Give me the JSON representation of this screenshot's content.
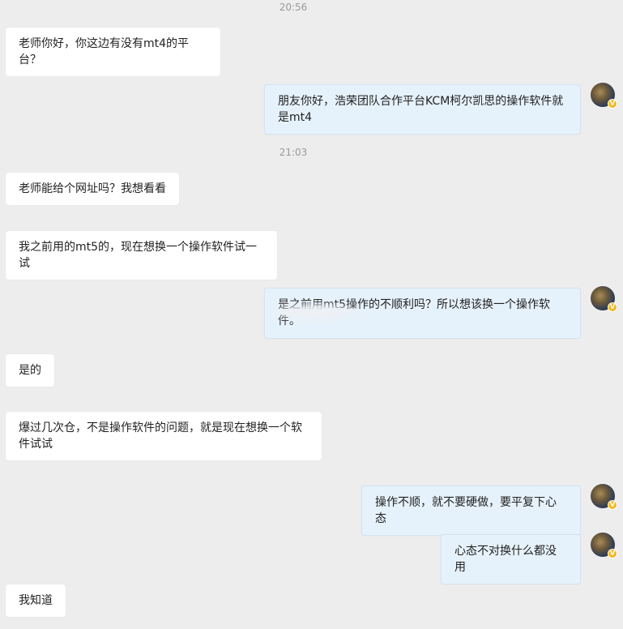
{
  "timestamps": [
    "20:56",
    "21:03"
  ],
  "messages": [
    {
      "side": "in",
      "text": "老师你好，你这边有没有mt4的平台？"
    },
    {
      "side": "out",
      "text": "朋友你好，浩荣团队合作平台KCM柯尔凯思的操作软件就是mt4"
    },
    {
      "side": "in",
      "text": "老师能给个网址吗？我想看看"
    },
    {
      "side": "in",
      "text": "我之前用的mt5的，现在想换一个操作软件试一试"
    },
    {
      "side": "out",
      "text": "是之前用mt5操作的不顺利吗？所以想该换一个操作软件。"
    },
    {
      "side": "in",
      "text": "是的"
    },
    {
      "side": "in",
      "text": "爆过几次仓，不是操作软件的问题，就是现在想换一个软件试试"
    },
    {
      "side": "out",
      "text": "操作不顺，就不要硬做，要平复下心态"
    },
    {
      "side": "out",
      "text": "心态不对换什么都没用"
    },
    {
      "side": "in",
      "text": "我知道"
    }
  ],
  "avatar_badge": "V",
  "colors": {
    "background": "#ededed",
    "incoming_bubble": "#ffffff",
    "outgoing_bubble": "#e6f2fb",
    "timestamp": "#9a9a9a"
  }
}
